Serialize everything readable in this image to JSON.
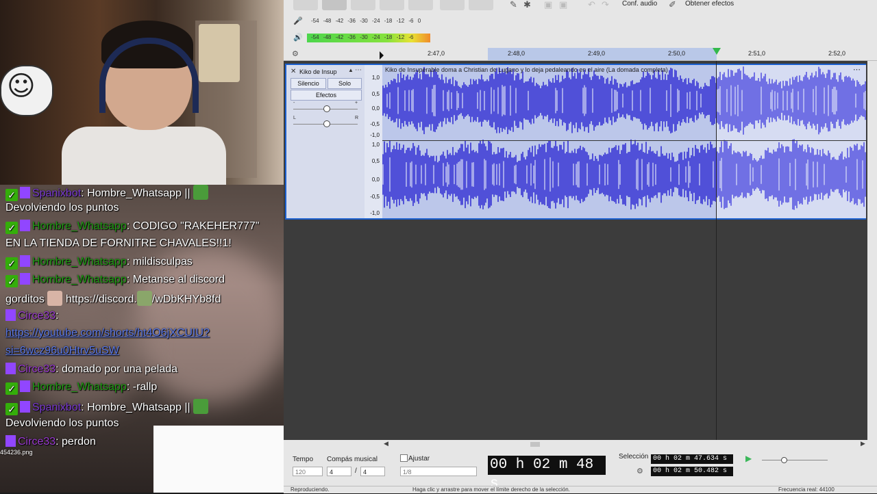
{
  "chat": {
    "messages": [
      {
        "user": "Spanixbot",
        "sep": ": ",
        "text": "Hombre_Whatsapp ||",
        "continuation": "Devolviendo los puntos"
      },
      {
        "user": "Hombre_Whatsapp",
        "sep": ": ",
        "text": "CODIGO \"RAKEHER777\"",
        "continuation": "EN LA TIENDA DE FORNITRE CHAVALES!!1!"
      },
      {
        "user": "Hombre_Whatsapp",
        "sep": ": ",
        "text": "mildisculpas"
      },
      {
        "user": "Hombre_Whatsapp",
        "sep": ": ",
        "text": "Metanse al discord",
        "continuation": "gorditos",
        "continuation_link": "https://discord.",
        "continuation_tail": "/wDbKHYb8fd"
      },
      {
        "user": "Circe33",
        "sep": ":",
        "text": "",
        "link": "https://youtube.com/shorts/ht4O6jXCUIU?",
        "link2": "si=6wcz96u0Htrv5uSW"
      },
      {
        "user": "Circe33",
        "sep": ": ",
        "text": "domado por una pelada"
      },
      {
        "user": "Hombre_Whatsapp",
        "sep": ": ",
        "text": "-rallp"
      },
      {
        "user": "Spanixbot",
        "sep": ": ",
        "text": "Hombre_Whatsapp ||",
        "continuation": "Devolviendo los puntos"
      },
      {
        "user": "Circe33",
        "sep": ": ",
        "text": "perdon"
      }
    ],
    "file_label": "454236.png"
  },
  "toolbar": {
    "audio_setup": "Conf. audio",
    "get_effects": "Obtener efectos",
    "rec_meter_scale": [
      "-54",
      "-48",
      "-42",
      "-36",
      "-30",
      "-24",
      "-18",
      "-12",
      "-6",
      "0"
    ],
    "play_meter_scale": [
      "-54",
      "-48",
      "-42",
      "-36",
      "-30",
      "-24",
      "-18",
      "-12",
      "-6"
    ]
  },
  "ruler": {
    "ticks": [
      "2:47,0",
      "2:48,0",
      "2:49,0",
      "2:50,0",
      "2:51,0",
      "2:52,0"
    ]
  },
  "track": {
    "name": "Kiko de Insup",
    "clip_title": "Kiko de Insuperable doma a Christian de Lugano y lo deja pedaleando en el aire (La domada completa)",
    "mute": "Silencio",
    "solo": "Solo",
    "effects": "Efectos",
    "pan_left": "L",
    "pan_right": "R",
    "scale_top": [
      "1,0",
      "0,5",
      "0,0",
      "-0,5",
      "-1,0"
    ],
    "scale_bottom": [
      "1,0",
      "0,5",
      "0,0",
      "-0,5",
      "-1,0"
    ]
  },
  "bottom": {
    "tempo_label": "Tempo",
    "tempo_value": "120",
    "meter_label": "Compás musical",
    "meter_num": "4",
    "meter_sep": "/",
    "meter_den": "4",
    "snap_label": "Ajustar",
    "snap_value": "1/8",
    "time_display": "00 h 02 m 48 s",
    "selection_label": "Selección",
    "sel_start": "00 h 02 m 47.634 s",
    "sel_end": "00 h 02 m 50.482 s"
  },
  "status": {
    "state": "Reproduciendo.",
    "hint": "Haga clic y arrastre para mover el límite derecho de la selección.",
    "rate": "Frecuencia real: 44100"
  },
  "colors": {
    "waveform": "#5050d8",
    "waveform_selected": "#7070e4",
    "selection_bg": "#bcc7ea",
    "track_border": "#1a5fcf",
    "play_head": "#33b94b",
    "mod_badge": "#34ae0a",
    "twitch_badge": "#9146ff",
    "username_green": "#1f9d13",
    "username_purple": "#9b3ad1"
  }
}
